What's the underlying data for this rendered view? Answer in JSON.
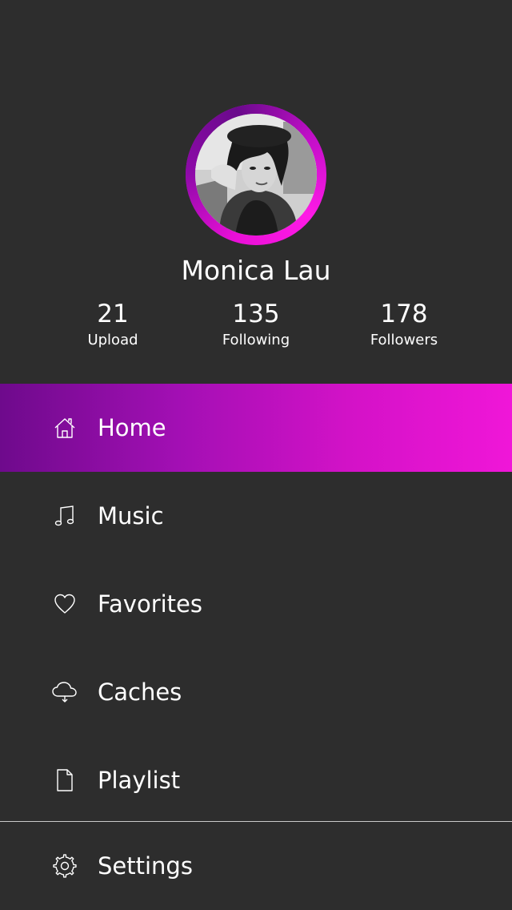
{
  "profile": {
    "name": "Monica Lau",
    "stats": [
      {
        "value": "21",
        "label": "Upload"
      },
      {
        "value": "135",
        "label": "Following"
      },
      {
        "value": "178",
        "label": "Followers"
      }
    ]
  },
  "menu": {
    "items": [
      {
        "label": "Home",
        "icon": "home-icon",
        "active": true
      },
      {
        "label": "Music",
        "icon": "music-note-icon",
        "active": false
      },
      {
        "label": "Favorites",
        "icon": "heart-icon",
        "active": false
      },
      {
        "label": "Caches",
        "icon": "cloud-download-icon",
        "active": false
      },
      {
        "label": "Playlist",
        "icon": "document-icon",
        "active": false
      }
    ],
    "settings": {
      "label": "Settings",
      "icon": "gear-icon"
    }
  },
  "colors": {
    "background": "#2d2d2d",
    "accent_start": "#6e0a8c",
    "accent_end": "#f016d8",
    "text": "#ffffff",
    "divider": "#c9c9c9"
  }
}
